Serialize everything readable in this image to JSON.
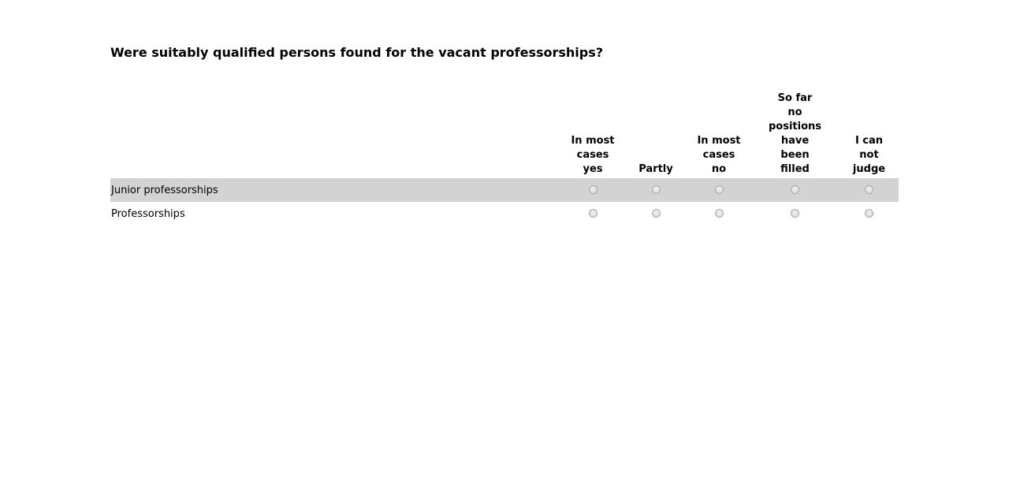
{
  "question": {
    "title": "Were suitably qualified persons found for the vacant professorships?"
  },
  "matrix": {
    "columns": [
      {
        "label": "In most\ncases\nyes"
      },
      {
        "label": "Partly"
      },
      {
        "label": "In most\ncases\nno"
      },
      {
        "label": "So far\nno\npositions\nhave\nbeen\nfilled"
      },
      {
        "label": "I can\nnot\njudge"
      }
    ],
    "rows": [
      {
        "label": "Junior professorships",
        "selected": null
      },
      {
        "label": "Professorships",
        "selected": null
      }
    ]
  },
  "colors": {
    "row_shade": "#d3d3d3",
    "radio_border": "#a9a9a9"
  }
}
